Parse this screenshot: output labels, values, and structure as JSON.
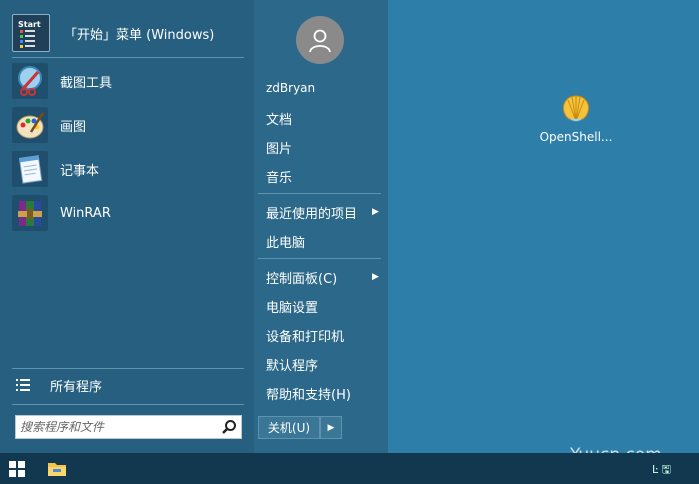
{
  "start_menu": {
    "pinned": [
      {
        "label": "「开始」菜单 (Windows)",
        "icon": "start-tile-icon"
      },
      {
        "label": "截图工具",
        "icon": "snipping-tool-icon"
      },
      {
        "label": "画图",
        "icon": "paint-palette-icon"
      },
      {
        "label": "记事本",
        "icon": "notepad-icon"
      },
      {
        "label": "WinRAR",
        "icon": "winrar-books-icon"
      }
    ],
    "start_tile_text": "Start",
    "all_programs_label": "所有程序",
    "search_placeholder": "搜索程序和文件",
    "username": "zdBryan",
    "right_items": [
      {
        "label": "文档"
      },
      {
        "label": "图片"
      },
      {
        "label": "音乐"
      },
      {
        "label": "最近使用的项目",
        "has_submenu": true
      },
      {
        "label": "此电脑"
      },
      {
        "label": "控制面板(C)",
        "has_submenu": true
      },
      {
        "label": "电脑设置"
      },
      {
        "label": "设备和打印机"
      },
      {
        "label": "默认程序"
      },
      {
        "label": "帮助和支持(H)"
      }
    ],
    "shutdown_label": "关机(U)",
    "arrow_glyph": "▶"
  },
  "desktop": {
    "icon_label": "OpenShell..."
  },
  "watermark": "Yuucn.com",
  "taskbar": {
    "tray_text": "Ŀ 🖫"
  },
  "colors": {
    "desktop": "#2d7fa9",
    "menu_left": "#265f80",
    "menu_right": "#2b6889",
    "taskbar": "#12384f"
  }
}
